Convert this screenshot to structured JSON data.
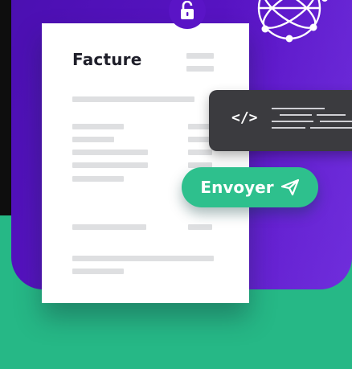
{
  "document": {
    "title": "Facture"
  },
  "code_chip": {
    "tag": "</>"
  },
  "send_button": {
    "label": "Envoyer"
  },
  "colors": {
    "background_green": "#26b886",
    "panel_purple": "#5a14c6",
    "button_green": "#2ec08d",
    "chip_dark": "#3b3b3f"
  },
  "icons": {
    "lock": "lock-icon",
    "send": "send-icon",
    "globe": "network-globe-icon"
  }
}
